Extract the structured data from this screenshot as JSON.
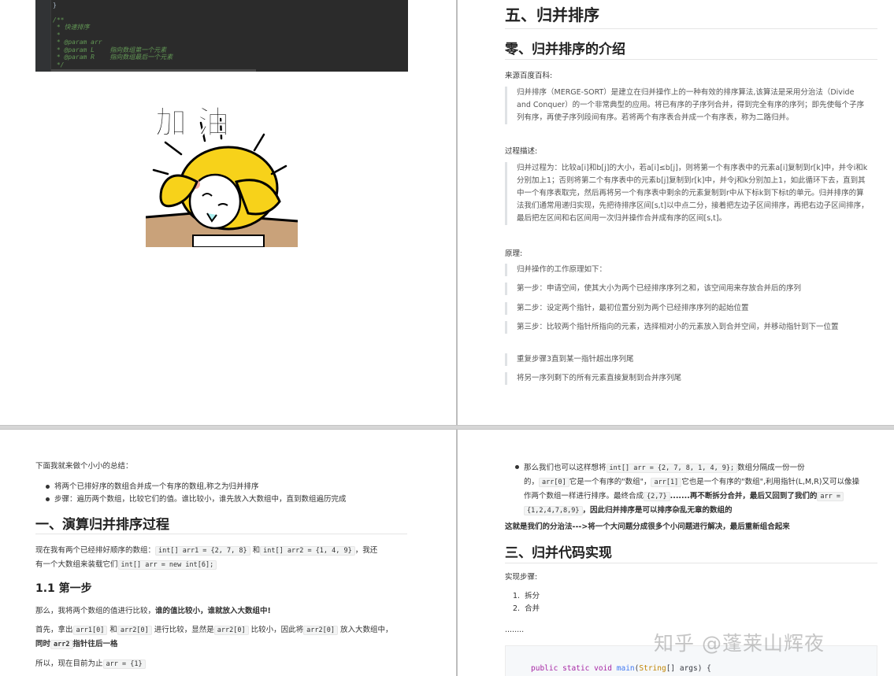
{
  "p1": {
    "code_lines": [
      "/**",
      " * 快速排序",
      " *",
      " * @param arr",
      " * @param L    指向数组第一个元素",
      " * @param R    指向数组最后一个元素",
      " */"
    ],
    "sticker_text": "加 油"
  },
  "p2": {
    "title": "五、归并排序",
    "subtitle": "零、归并排序的介绍",
    "source_label": "来源百度百科:",
    "source_quote": "归并排序（MERGE-SORT）是建立在归并操作上的一种有效的排序算法,该算法是采用分治法（Divide and Conquer）的一个非常典型的应用。将已有序的子序列合并，得到完全有序的序列；即先使每个子序列有序，再使子序列段间有序。若将两个有序表合并成一个有序表，称为二路归并。",
    "process_label": "过程描述:",
    "process_quote": "归并过程为：比较a[i]和b[j]的大小，若a[i]≤b[j]，则将第一个有序表中的元素a[i]复制到r[k]中，并令i和k分别加上1；否则将第二个有序表中的元素b[j]复制到r[k]中，并令j和k分别加上1，如此循环下去，直到其中一个有序表取完，然后再将另一个有序表中剩余的元素复制到r中从下标k到下标t的单元。归并排序的算法我们通常用递归实现，先把待排序区间[s,t]以中点二分，接着把左边子区间排序，再把右边子区间排序，最后把左区间和右区间用一次归并操作合并成有序的区间[s,t]。",
    "principle_label": "原理:",
    "principle_items": [
      "归并操作的工作原理如下：",
      "第一步：申请空间，使其大小为两个已经排序序列之和，该空间用来存放合并后的序列",
      "第二步：设定两个指针，最初位置分别为两个已经排序序列的起始位置",
      "第三步：比较两个指针所指向的元素，选择相对小的元素放入到合并空间，并移动指针到下一位置",
      "重复步骤3直到某一指针超出序列尾",
      "将另一序列剩下的所有元素直接复制到合并序列尾"
    ]
  },
  "p3": {
    "intro": "下面我就来做个小小的总结：",
    "bullet1": "将两个已排好序的数组合并成一个有序的数组,称之为归并排序",
    "bullet2": "步骤：遍历两个数组，比较它们的值。谁比较小，谁先放入大数组中，直到数组遍历完成",
    "heading1": "一、演算归并排序过程",
    "para1_a": "现在我有两个已经排好顺序的数组：",
    "para1_code1": "int[] arr1 = {2, 7, 8}",
    "para1_b": "和",
    "para1_code2": "int[] arr2 = {1, 4, 9}",
    "para1_c": "，我还",
    "para1_d": "有一个大数组来装载它们",
    "para1_code3": "int[] arr = new int[6];",
    "heading2": "1.1 第一步",
    "para2_a": "那么，我将两个数组的值进行比较，",
    "para2_b": "谁的值比较小，谁就放入大数组中!",
    "para3_a": "首先，拿出",
    "para3_code1": "arr1[0]",
    "para3_b": "和",
    "para3_code2": "arr2[0]",
    "para3_c": "进行比较，显然是",
    "para3_code3": "arr2[0]",
    "para3_d": "比较小，因此将",
    "para3_code4": "arr2[0]",
    "para3_e": "放入大数组中，",
    "para3_f": "同时",
    "para3_code5": "arr2",
    "para3_g": "指针往后一格",
    "para4_a": "所以，现在目前为止",
    "para4_code": "arr = {1}"
  },
  "p4": {
    "b_a": "那么我们也可以这样想将",
    "b_code1": "int[] arr = {2, 7, 8, 1, 4, 9};",
    "b_b": "数组分隔成一份一份",
    "b_c": "的，",
    "b_code2": "arr[0]",
    "b_d": "它是一个有序的\"数组\"，",
    "b_code3": "arr[1]",
    "b_e": "它也是一个有序的\"数组\",利用指针(L,M,R)又可以像操",
    "b_f": "作两个数组一样进行排序。最终合成",
    "b_code4": "{2,7}",
    "b_g": ".......再不断拆分合并，最后又回到了我们的",
    "b_code5": "arr =",
    "b_code6": "{1,2,4,7,8,9}",
    "b_h": "，因此归并排序是可以排序杂乱无章的数组的",
    "conclusion": "这就是我们的分治法--->将一个大问题分成很多个小问题进行解决，最后重新组合起来",
    "heading": "三、归并代码实现",
    "steps_label": "实现步骤:",
    "steps": [
      "拆分",
      "合并"
    ],
    "ellipsis": "........",
    "code_kw1": "public",
    "code_kw2": "static",
    "code_kw3": "void",
    "code_fn": "main",
    "code_ty": "String",
    "code_rest": "[] args) {"
  },
  "watermark": "知乎 @蓬莱山辉夜"
}
